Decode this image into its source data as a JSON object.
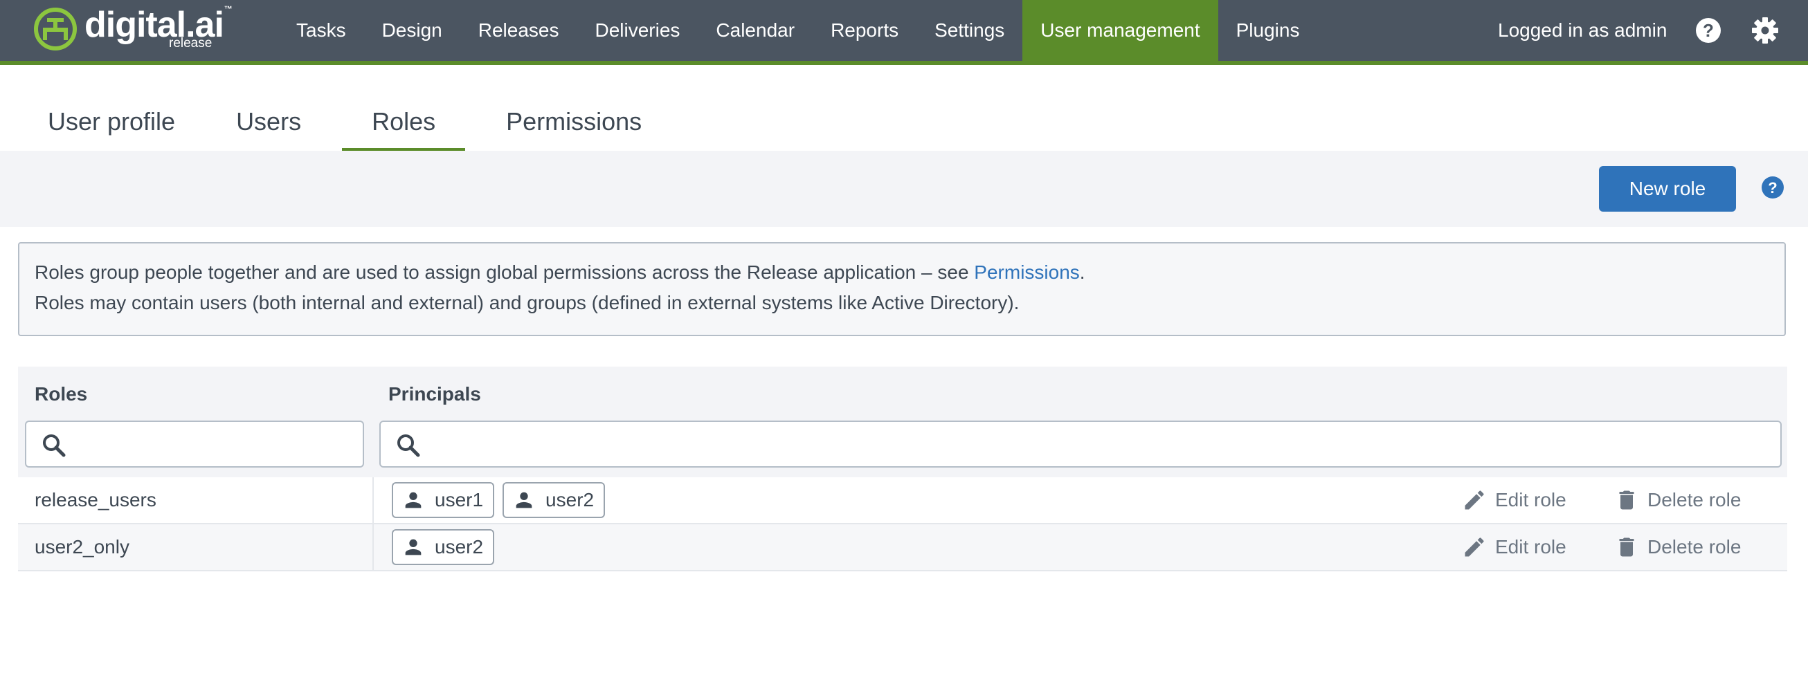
{
  "brand": {
    "name": "digital.ai",
    "trademark": "™",
    "product": "release"
  },
  "nav": {
    "items": [
      "Tasks",
      "Design",
      "Releases",
      "Deliveries",
      "Calendar",
      "Reports",
      "Settings",
      "User management",
      "Plugins"
    ],
    "active": "User management",
    "logged_in": "Logged in as admin",
    "help_icon": "question-circle-icon",
    "settings_icon": "gear-icon"
  },
  "tabs": {
    "items": [
      "User profile",
      "Users",
      "Roles",
      "Permissions"
    ],
    "active": "Roles"
  },
  "toolbar": {
    "new_role_label": "New role",
    "help_icon": "question-circle-icon"
  },
  "info": {
    "line1_prefix": "Roles group people together and are used to assign global permissions across the Release application – see ",
    "line1_link": "Permissions",
    "line1_suffix": ".",
    "line2": "Roles may contain users (both internal and external) and groups (defined in external systems like Active Directory)."
  },
  "table": {
    "headers": {
      "roles": "Roles",
      "principals": "Principals"
    },
    "roles_search_value": "",
    "principals_search_value": "",
    "rows": [
      {
        "role": "release_users",
        "principals": [
          "user1",
          "user2"
        ],
        "edit_label": "Edit role",
        "delete_label": "Delete role"
      },
      {
        "role": "user2_only",
        "principals": [
          "user2"
        ],
        "edit_label": "Edit role",
        "delete_label": "Delete role"
      }
    ]
  },
  "colors": {
    "topbar": "#4b5561",
    "accent_green": "#5b8c2a",
    "primary_blue": "#2f73ba"
  }
}
